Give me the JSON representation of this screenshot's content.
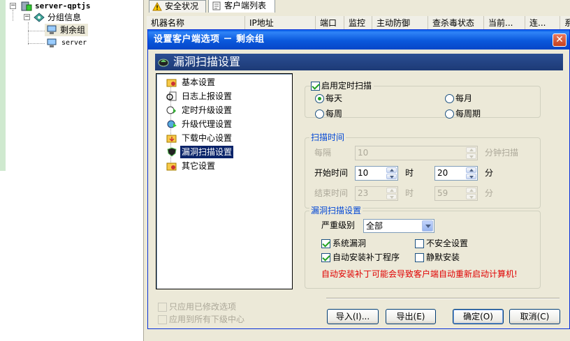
{
  "tree": {
    "server_name": "server-qptjs",
    "group_info": "分组信息",
    "remaining_group": "剩余组",
    "server_child": "server"
  },
  "tabs": [
    {
      "label": "安全状况"
    },
    {
      "label": "客户端列表"
    }
  ],
  "list_columns": [
    "机器名称",
    "IP地址",
    "端口",
    "监控",
    "主动防御",
    "查杀毒状态",
    "当前...",
    "连...",
    "系"
  ],
  "dialog": {
    "title": "设置客户端选项 － 剩余组",
    "close_symbol": "✕",
    "section_title": "漏洞扫描设置",
    "nav": [
      {
        "label": "基本设置"
      },
      {
        "label": "日志上报设置"
      },
      {
        "label": "定时升级设置"
      },
      {
        "label": "升级代理设置"
      },
      {
        "label": "下载中心设置"
      },
      {
        "label": "漏洞扫描设置"
      },
      {
        "label": "其它设置"
      }
    ],
    "selected_nav": 5,
    "schedule": {
      "enable_label": "启用定时扫描",
      "enabled": true,
      "daily": "每天",
      "monthly": "每月",
      "weekly": "每周",
      "per_week": "每周期",
      "selected": "daily"
    },
    "scan_time": {
      "group_title": "扫描时间",
      "interval_label": "每隔",
      "interval_value": "10",
      "interval_unit": "分钟扫描",
      "start_label": "开始时间",
      "start_hour": "10",
      "hour_unit": "时",
      "start_minute": "20",
      "minute_unit": "分",
      "end_label": "结束时间",
      "end_hour": "23",
      "end_minute": "59"
    },
    "vuln": {
      "group_title": "漏洞扫描设置",
      "severity_label": "严重级别",
      "severity_value": "全部",
      "system_vuln": "系统漏洞",
      "system_vuln_checked": true,
      "unsafe_settings": "不安全设置",
      "unsafe_settings_checked": false,
      "auto_install": "自动安装补丁程序",
      "auto_install_checked": true,
      "silent_install": "静默安装",
      "silent_install_checked": false,
      "warning": "自动安装补丁可能会导致客户端自动重新启动计算机!"
    },
    "footer": {
      "apply_modified": "只应用已修改选项",
      "apply_children": "应用到所有下级中心",
      "import": "导入(I)...",
      "export": "导出(E)",
      "ok": "确定(O)",
      "cancel": "取消(C)"
    }
  },
  "colors": {
    "titlebar": "#0a58dc",
    "section_bar": "#1d3a76",
    "group_title": "#0046d5",
    "warning": "#e00000",
    "selection": "#0a246a"
  }
}
